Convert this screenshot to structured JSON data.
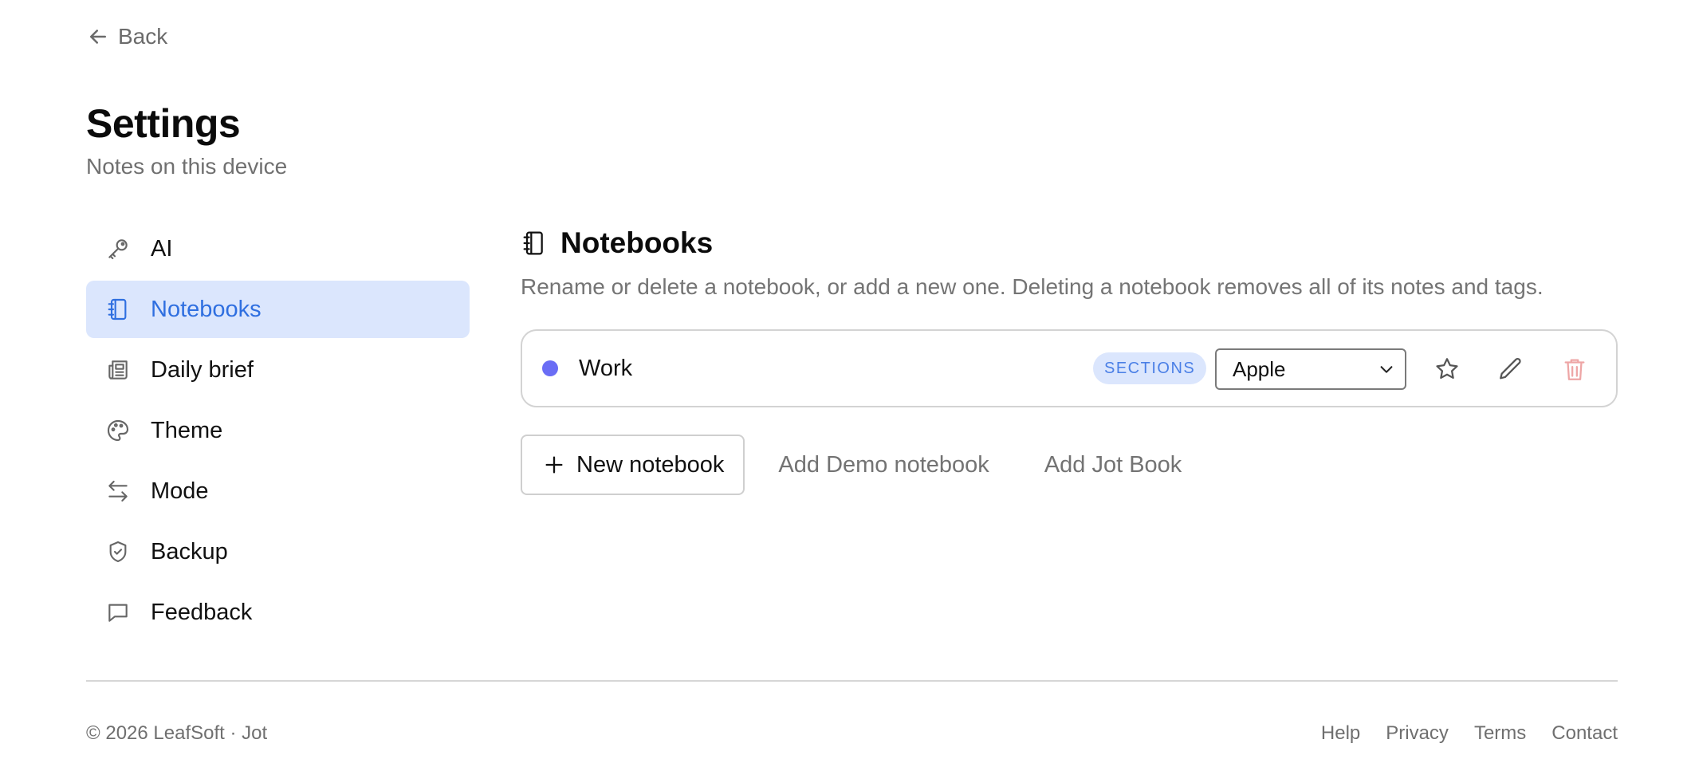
{
  "header": {
    "back_label": "Back",
    "title": "Settings",
    "subtitle": "Notes on this device"
  },
  "sidebar": {
    "items": [
      {
        "label": "AI",
        "icon": "key-icon",
        "active": false
      },
      {
        "label": "Notebooks",
        "icon": "notebook-icon",
        "active": true
      },
      {
        "label": "Daily brief",
        "icon": "newspaper-icon",
        "active": false
      },
      {
        "label": "Theme",
        "icon": "palette-icon",
        "active": false
      },
      {
        "label": "Mode",
        "icon": "arrows-swap-icon",
        "active": false
      },
      {
        "label": "Backup",
        "icon": "shield-check-icon",
        "active": false
      },
      {
        "label": "Feedback",
        "icon": "chat-bubble-icon",
        "active": false
      }
    ]
  },
  "main": {
    "title": "Notebooks",
    "description": "Rename or delete a notebook, or add a new one. Deleting a notebook removes all of its notes and tags.",
    "notebooks": [
      {
        "name": "Work",
        "color": "#6a6df5",
        "badge": "SECTIONS",
        "select_value": "Apple"
      }
    ],
    "new_notebook_label": "New notebook",
    "add_demo_label": "Add Demo notebook",
    "add_jot_label": "Add Jot Book"
  },
  "footer": {
    "copyright": "© 2026 LeafSoft · Jot",
    "links": [
      "Help",
      "Privacy",
      "Terms",
      "Contact"
    ]
  },
  "colors": {
    "accent": "#2f6fe0",
    "active_bg": "#dbe6fd",
    "danger": "#eea6a6"
  }
}
